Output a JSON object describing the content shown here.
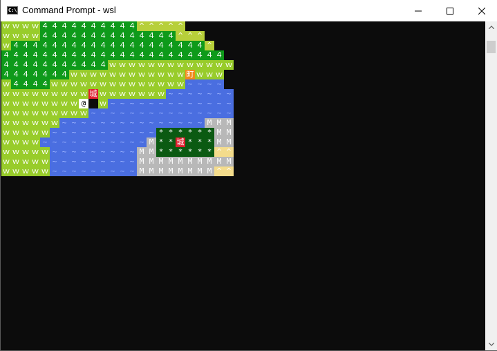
{
  "window": {
    "title": "Command Prompt - wsl",
    "icon_label": "C:\\",
    "minimize_icon": "minimize-icon",
    "maximize_icon": "maximize-icon",
    "close_icon": "close-icon"
  },
  "colors": {
    "terminal_bg": "#0c0c0c",
    "grass": "#98cc2a",
    "forest": "#0e9a1a",
    "hill": "#b7cf3a",
    "water": "#4a6ee0",
    "mountain": "#b8b8b8",
    "sand": "#f4dc8c",
    "dark_forest": "#0b5a12",
    "castle_bg": "#e02030",
    "town_bg": "#f08a1a"
  },
  "map": {
    "rows": [
      "wwwwGGGGGGGGGGhhhhh",
      "wwwwGGGGGGGGGGGGGGhhh",
      "wGGGGGGGGGGGGGGGGGGGGh",
      "GGGGGGGGGGGGGGGGGGGGGGG",
      "GGGGGGGGGGGwwwwwwwwwwwww",
      "GGGGGGGwwwwwwwwwwwwTwww",
      "wGGGGwwwwwwwwwwwwwwWWWW",
      "wwwwwwwwwCwwwwwwwWWWWWWW",
      "wwwwwwwwP@wWWWWWWWWWWWWW",
      "wwwwwwwwwWWWWWWWWWWWWWWW",
      "wwwwwwWWWWWWWWWWWWWWWMMM",
      "wwwwwWWWWWWWWWWWKKKKKKMM",
      "wwwwWWWWWWWWWWWMKKCKKKMM",
      "wwwwwWWWWWWWWWMMKKKKKKSS",
      "wwwwwWWWWWWWWWMMMMMMMMMM",
      "wwwwwWWWWWWWWWMMMMMMMMSS"
    ],
    "glyphs": {
      "w": "ｗ",
      "G": "４",
      "h": "^",
      "W": "~",
      "M": "M",
      "S": "^",
      "K": "*",
      "C": "城",
      "T": "町",
      "P": "@"
    }
  },
  "scrollbar": {
    "up_icon": "scroll-up-arrow-icon",
    "down_icon": "scroll-down-arrow-icon"
  }
}
